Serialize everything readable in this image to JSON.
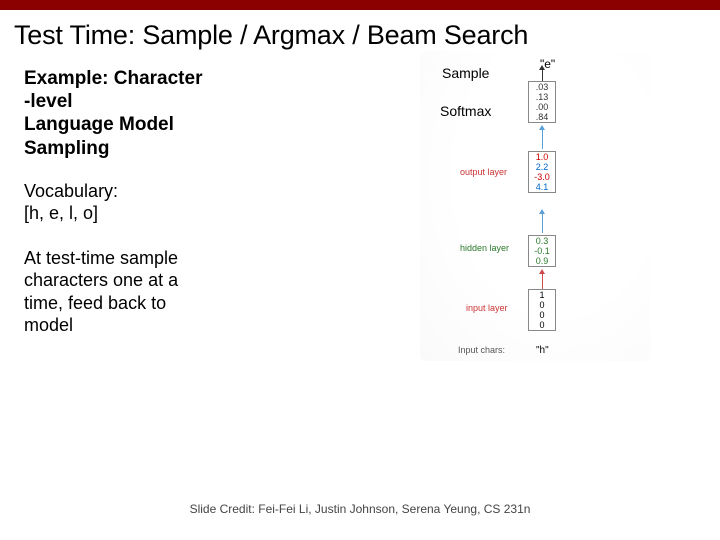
{
  "title": "Test Time: Sample / Argmax / Beam Search",
  "subhead_l1": "Example: Character",
  "subhead_l2": "-level",
  "subhead_l3": "Language Model",
  "subhead_l4": "Sampling",
  "vocab_l1": "Vocabulary:",
  "vocab_l2": "[h, e, l, o]",
  "test_l1": "At test-time sample",
  "test_l2": "characters one at a",
  "test_l3": "time, feed back to",
  "test_l4": "model",
  "labels": {
    "sample": "Sample",
    "softmax": "Softmax",
    "output": "output layer",
    "hidden": "hidden layer",
    "input": "input layer",
    "chars": "Input chars:",
    "hchar": "\"h\"",
    "echar": "\"e\""
  },
  "softmax": {
    "v0": ".03",
    "v1": ".13",
    "v2": ".00",
    "v3": ".84"
  },
  "output": {
    "v0": "1.0",
    "v1": "2.2",
    "v2": "-3.0",
    "v3": "4.1"
  },
  "hidden": {
    "v0": "0.3",
    "v1": "-0.1",
    "v2": "0.9"
  },
  "input": {
    "v0": "1",
    "v1": "0",
    "v2": "0",
    "v3": "0"
  },
  "credit": "Slide Credit: Fei-Fei Li, Justin Johnson, Serena Yeung, CS 231n"
}
